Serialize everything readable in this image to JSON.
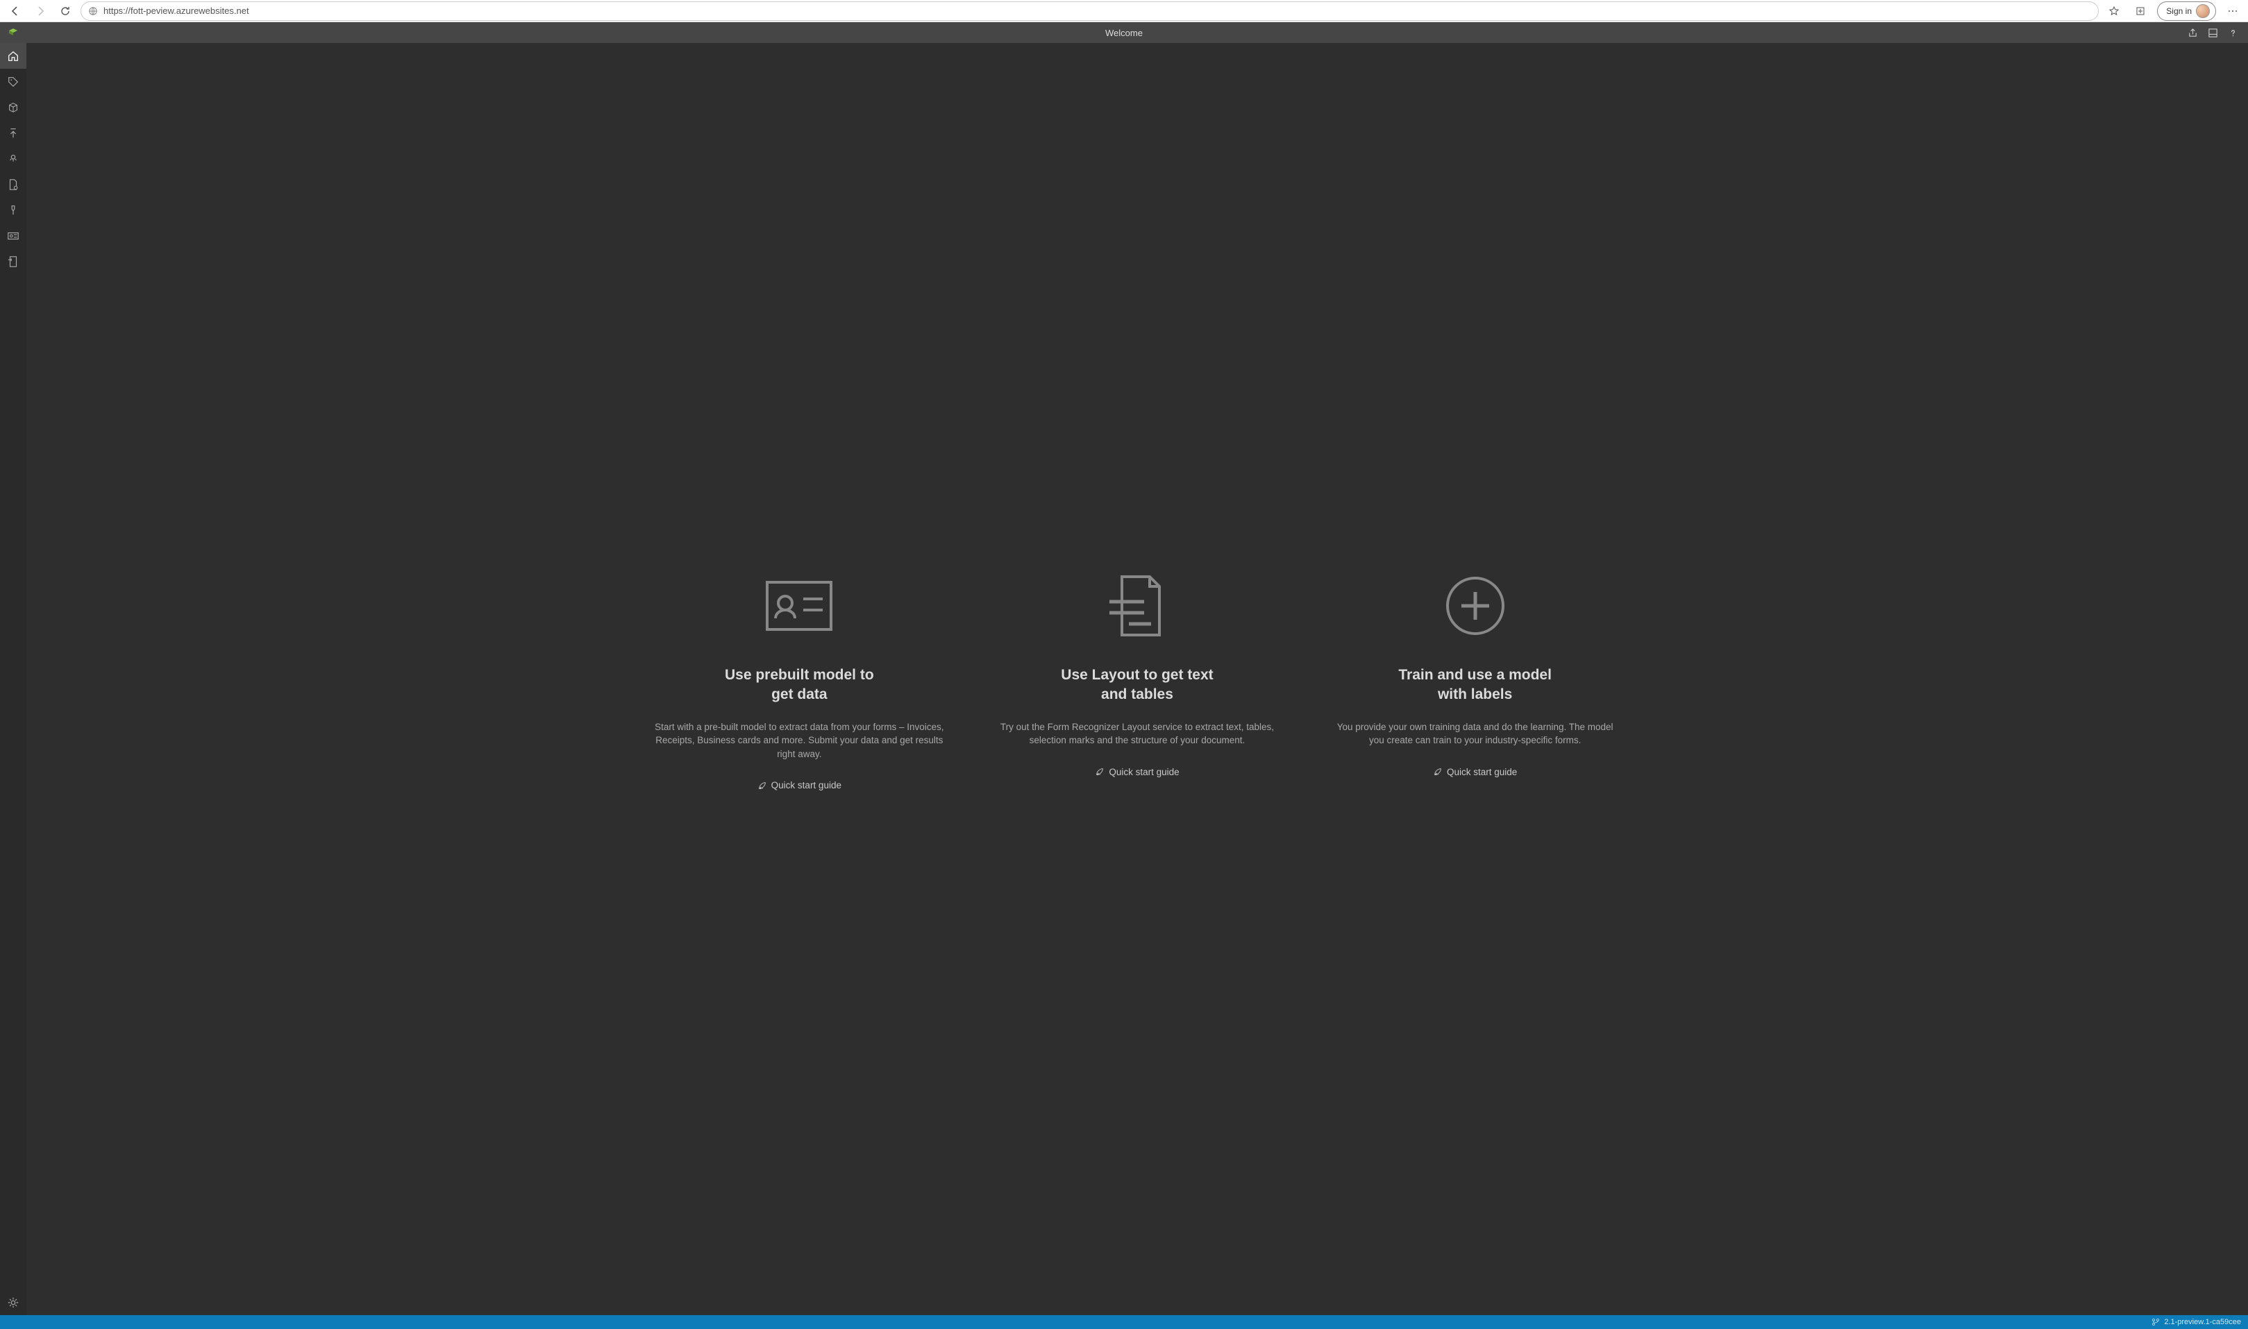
{
  "browser": {
    "url": "https://fott-peview.azurewebsites.net",
    "signin_label": "Sign in"
  },
  "header": {
    "tab_title": "Welcome"
  },
  "cards": [
    {
      "title_line1": "Use prebuilt model to",
      "title_line2": "get data",
      "description": "Start with a pre-built model to extract data from your forms – Invoices, Receipts, Business cards and more. Submit your data and get results right away.",
      "link_label": "Quick start guide"
    },
    {
      "title_line1": "Use Layout to get text",
      "title_line2": "and tables",
      "description": "Try out the Form Recognizer Layout service to extract text, tables, selection marks and the structure of your document.",
      "link_label": "Quick start guide"
    },
    {
      "title_line1": "Train and use a model",
      "title_line2": "with labels",
      "description": "You provide your own training data and do the learning. The model you create can train to your industry-specific forms.",
      "link_label": "Quick start guide"
    }
  ],
  "statusbar": {
    "version": "2.1-preview.1-ca59cee"
  }
}
